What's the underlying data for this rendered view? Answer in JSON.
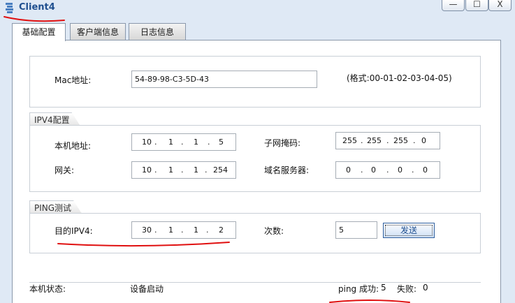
{
  "window": {
    "title": "Client4",
    "min_glyph": "—",
    "max_glyph": "☐",
    "close_glyph": "X"
  },
  "tabs": [
    {
      "label": "基础配置",
      "active": true
    },
    {
      "label": "客户端信息",
      "active": false
    },
    {
      "label": "日志信息",
      "active": false
    }
  ],
  "mac": {
    "label": "Mac地址:",
    "value": "54-89-98-C3-5D-43",
    "hint": "(格式:00-01-02-03-04-05)"
  },
  "ipv4": {
    "group_label": "IPV4配置",
    "local_ip": {
      "label": "本机地址:",
      "octets": [
        "10",
        "1",
        "1",
        "5"
      ]
    },
    "subnet_mask": {
      "label": "子网掩码:",
      "octets": [
        "255",
        "255",
        "255",
        "0"
      ]
    },
    "gateway": {
      "label": "网关:",
      "octets": [
        "10",
        "1",
        "1",
        "254"
      ]
    },
    "dns_server": {
      "label": "域名服务器:",
      "octets": [
        "0",
        "0",
        "0",
        "0"
      ]
    }
  },
  "ping": {
    "group_label": "PING测试",
    "target": {
      "label": "目的IPV4:",
      "octets": [
        "30",
        "1",
        "1",
        "2"
      ]
    },
    "count": {
      "label": "次数:",
      "value": "5"
    },
    "send_label": "发送"
  },
  "status": {
    "label": "本机状态:",
    "value": "设备启动",
    "success_label": "ping 成功:",
    "success_count": "5",
    "fail_label": "失败:",
    "fail_count": "0"
  },
  "dot": "."
}
